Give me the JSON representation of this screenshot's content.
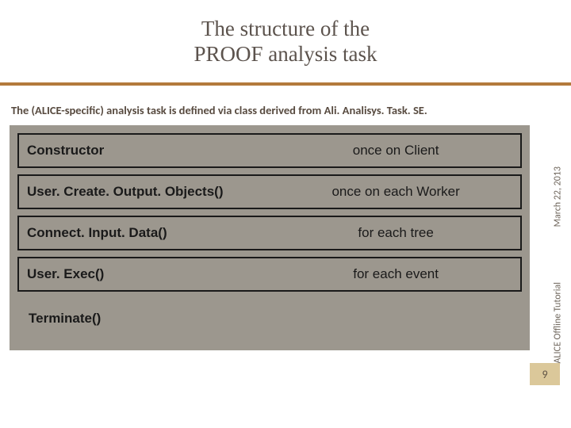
{
  "header": {
    "title_line1": "The structure of the",
    "title_line2": "PROOF analysis task"
  },
  "description": "The (ALICE-specific) analysis task is defined via class derived from Ali. Analisys. Task. SE.",
  "rows": [
    {
      "method": "Constructor",
      "bold": true,
      "freq": "once on Client"
    },
    {
      "method": "User. Create. Output. Objects()",
      "bold": true,
      "freq": "once on each Worker"
    },
    {
      "method": "Connect. Input. Data()",
      "bold": true,
      "freq": "for each tree"
    },
    {
      "method": "User. Exec()",
      "bold": true,
      "freq": "for each event"
    }
  ],
  "terminate_label": "Terminate()",
  "side": {
    "date": "March 22, 2013",
    "tutorial": "ALICE Offline Tutorial"
  },
  "page_number": "9"
}
